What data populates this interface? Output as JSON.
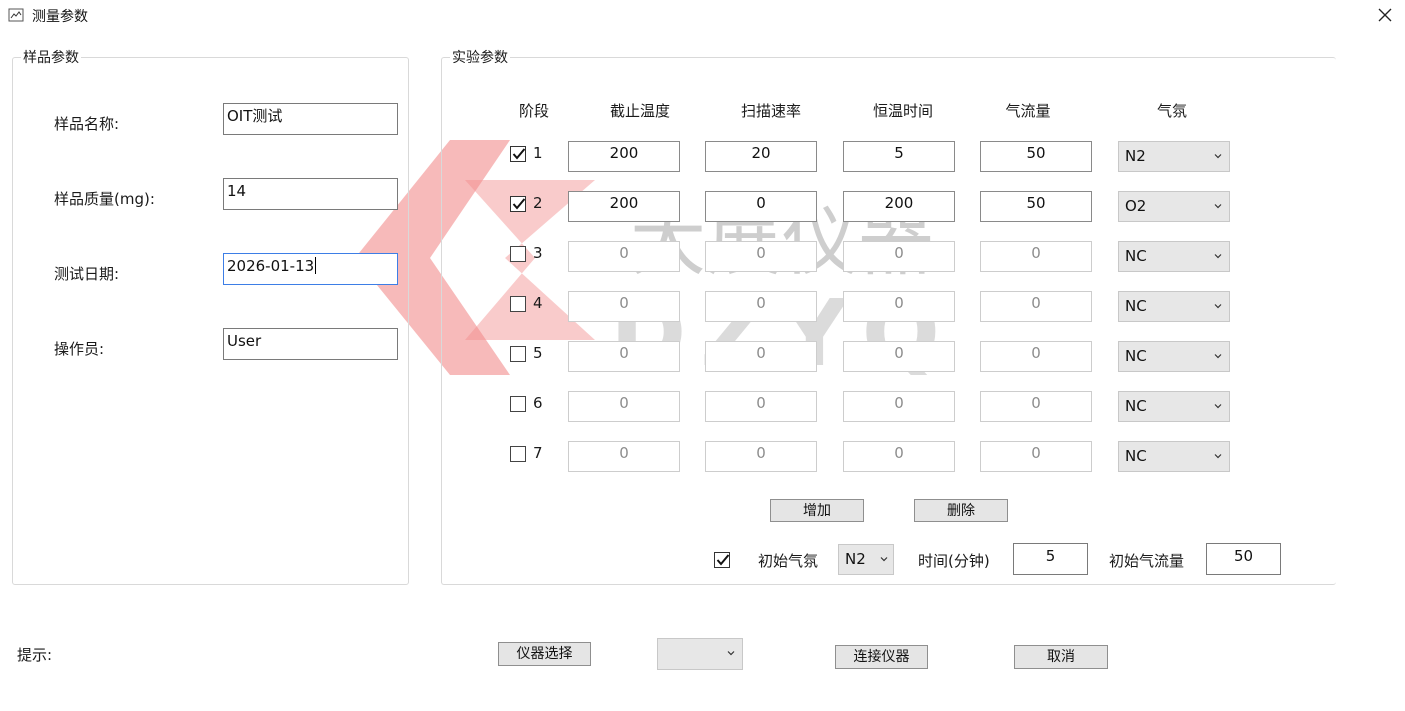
{
  "window": {
    "title": "测量参数"
  },
  "sample": {
    "group_title": "样品参数",
    "name_label": "样品名称:",
    "name_value": "OIT测试",
    "mass_label": "样品质量(mg):",
    "mass_value": "14",
    "date_label": "测试日期:",
    "date_value": "2026-01-13",
    "operator_label": "操作员:",
    "operator_value": "User"
  },
  "experiment": {
    "group_title": "实验参数",
    "columns": [
      "阶段",
      "截止温度",
      "扫描速率",
      "恒温时间",
      "气流量",
      "气氛"
    ],
    "stages": [
      {
        "no": "1",
        "checked": true,
        "end_temp": "200",
        "rate": "20",
        "hold": "5",
        "flow": "50",
        "atmosphere": "N2"
      },
      {
        "no": "2",
        "checked": true,
        "end_temp": "200",
        "rate": "0",
        "hold": "200",
        "flow": "50",
        "atmosphere": "O2"
      },
      {
        "no": "3",
        "checked": false,
        "end_temp": "0",
        "rate": "0",
        "hold": "0",
        "flow": "0",
        "atmosphere": "NC"
      },
      {
        "no": "4",
        "checked": false,
        "end_temp": "0",
        "rate": "0",
        "hold": "0",
        "flow": "0",
        "atmosphere": "NC"
      },
      {
        "no": "5",
        "checked": false,
        "end_temp": "0",
        "rate": "0",
        "hold": "0",
        "flow": "0",
        "atmosphere": "NC"
      },
      {
        "no": "6",
        "checked": false,
        "end_temp": "0",
        "rate": "0",
        "hold": "0",
        "flow": "0",
        "atmosphere": "NC"
      },
      {
        "no": "7",
        "checked": false,
        "end_temp": "0",
        "rate": "0",
        "hold": "0",
        "flow": "0",
        "atmosphere": "NC"
      }
    ],
    "add_button": "增加",
    "delete_button": "删除",
    "initial": {
      "checked": true,
      "atmosphere_label": "初始气氛",
      "atmosphere_value": "N2",
      "time_label": "时间(分钟)",
      "time_value": "5",
      "flow_label": "初始气流量",
      "flow_value": "50"
    }
  },
  "footer": {
    "hint_label": "提示:",
    "instrument_select_button": "仪器选择",
    "instrument_combo_value": "",
    "connect_button": "连接仪器",
    "cancel_button": "取消"
  },
  "watermark": {
    "cn_text": "大展仪器",
    "en_text": "DZYQ"
  },
  "colors": {
    "focus_border": "#3d7ee6",
    "watermark_red": "#f28b8b",
    "watermark_gray": "#9a9a9a"
  }
}
